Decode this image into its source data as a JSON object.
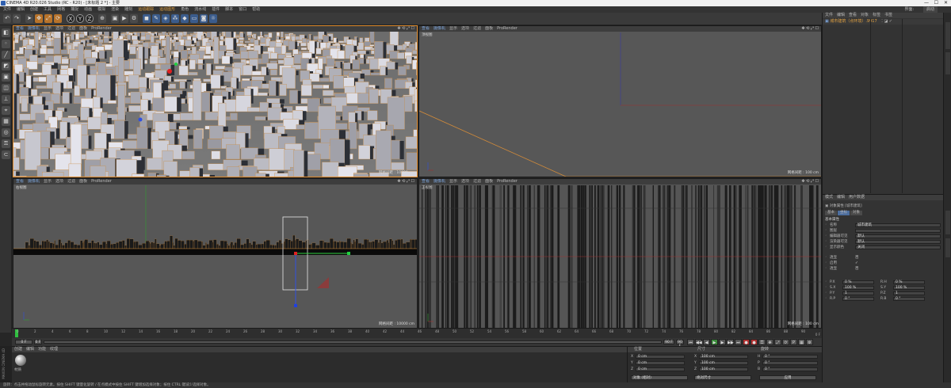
{
  "window": {
    "title": "CINEMA 4D R20.026 Studio (RC - R20) - [未标题 2 *] - 主要",
    "min": "—",
    "max": "☐",
    "close": "✕"
  },
  "menubar": {
    "items": [
      "文件",
      "编辑",
      "创建",
      "工具",
      "网格",
      "捕捉",
      "动画",
      "模拟",
      "渲染",
      "雕刻",
      "运动跟踪",
      "运动图形",
      "角色",
      "流水线",
      "插件",
      "脚本",
      "窗口",
      "帮助"
    ],
    "highlight": [
      "运动跟踪",
      "运动图形"
    ],
    "right_label": "界面:",
    "right_value": "启动"
  },
  "toolbar": {
    "icons": [
      "undo",
      "redo",
      "select",
      "move",
      "scale",
      "rotate",
      "x-axis",
      "y-axis",
      "z-axis",
      "world",
      "render-view",
      "render",
      "render-settings",
      "cube",
      "pen",
      "subdivide",
      "cloner",
      "deformer",
      "floor",
      "camera",
      "light"
    ]
  },
  "viewports": {
    "tl": {
      "name": "透视视图",
      "scale": "网格间距 : 10000 cm",
      "menu": [
        "查看",
        "摄像机",
        "显示",
        "选项",
        "过滤",
        "面板",
        "ProRender"
      ]
    },
    "tr": {
      "name": "顶视图",
      "scale": "网格间距 : 100 cm",
      "menu": [
        "查看",
        "摄像机",
        "显示",
        "选项",
        "过滤",
        "面板",
        "ProRender"
      ]
    },
    "bl": {
      "name": "右视图",
      "scale": "网格间距 : 10000 cm",
      "menu": [
        "查看",
        "摄像机",
        "显示",
        "选项",
        "过滤",
        "面板",
        "ProRender"
      ]
    },
    "br": {
      "name": "正视图",
      "scale": "网格间距 : 100 cm",
      "menu": [
        "查看",
        "摄像机",
        "显示",
        "选项",
        "过滤",
        "面板",
        "ProRender"
      ]
    }
  },
  "timeline": {
    "ticks": [
      "0",
      "2",
      "4",
      "6",
      "8",
      "10",
      "12",
      "14",
      "16",
      "18",
      "20",
      "22",
      "24",
      "26",
      "28",
      "30",
      "32",
      "34",
      "36",
      "38",
      "40",
      "42",
      "44",
      "46",
      "48",
      "50",
      "52",
      "54",
      "56",
      "58",
      "60",
      "62",
      "64",
      "66",
      "68",
      "70",
      "72",
      "74",
      "76",
      "78",
      "80",
      "82",
      "84",
      "86",
      "88",
      "90"
    ],
    "end_label": "0 F",
    "start_field": "0 F",
    "current_field": "0 F",
    "end_field": "90 F",
    "max_field": "90 F"
  },
  "material_manager": {
    "menu": [
      "创建",
      "编辑",
      "功能",
      "纹理"
    ],
    "material_name": "材质"
  },
  "coordinates": {
    "headers": [
      "位置",
      "尺寸",
      "旋转"
    ],
    "rows": [
      {
        "axis": "X",
        "pos": "0 cm",
        "size_axis": "X",
        "size": "100 cm",
        "rot_axis": "H",
        "rot": "0 °"
      },
      {
        "axis": "Y",
        "pos": "0 cm",
        "size_axis": "Y",
        "size": "100 cm",
        "rot_axis": "P",
        "rot": "0 °"
      },
      {
        "axis": "Z",
        "pos": "0 cm",
        "size_axis": "Z",
        "size": "100 cm",
        "rot_axis": "B",
        "rot": "0 °"
      }
    ],
    "mode_select": "对象 (相对)",
    "size_select": "绝对尺寸",
    "apply": "应用"
  },
  "object_manager": {
    "menu": [
      "文件",
      "编辑",
      "查看",
      "对象",
      "标签",
      "书签"
    ],
    "object": "城市建筑（点环境）.9917"
  },
  "attribute_manager": {
    "menu": [
      "模式",
      "编辑",
      "用户数据"
    ],
    "title": "对象属性 [城市建筑]",
    "tabs": [
      "基本",
      "坐标",
      "对象"
    ],
    "section": "基本属性",
    "fields": [
      {
        "label": "名称",
        "value": "城市建筑"
      },
      {
        "label": "图层",
        "value": ""
      },
      {
        "label": "编辑器可见",
        "value": "默认"
      },
      {
        "label": "渲染器可见",
        "value": "默认"
      },
      {
        "label": "显示颜色",
        "value": "关闭"
      }
    ],
    "checks": [
      {
        "label": "透显",
        "value": "否"
      },
      {
        "label": "启用",
        "value": "✓"
      },
      {
        "label": "透显",
        "value": "否"
      }
    ],
    "coords": [
      {
        "l1": "P.X",
        "v1": "0 %",
        "l2": "R.H",
        "v2": "0 %"
      },
      {
        "l1": "S.X",
        "v1": "100 %",
        "l2": "S.Y",
        "v2": "100 %"
      },
      {
        "l1": "P.Y",
        "v1": "1",
        "l2": "P.Z",
        "v2": "1"
      },
      {
        "l1": "R.P",
        "v1": "0 °",
        "l2": "R.B",
        "v2": "0 °"
      }
    ]
  },
  "status": "旋转：点击并拖动鼠标旋转元素。按住 SHIFT 键量化旋转 / 在点模式中按住 SHIFT 键增加选择对象；按住 CTRL 键减少选择对象。"
}
